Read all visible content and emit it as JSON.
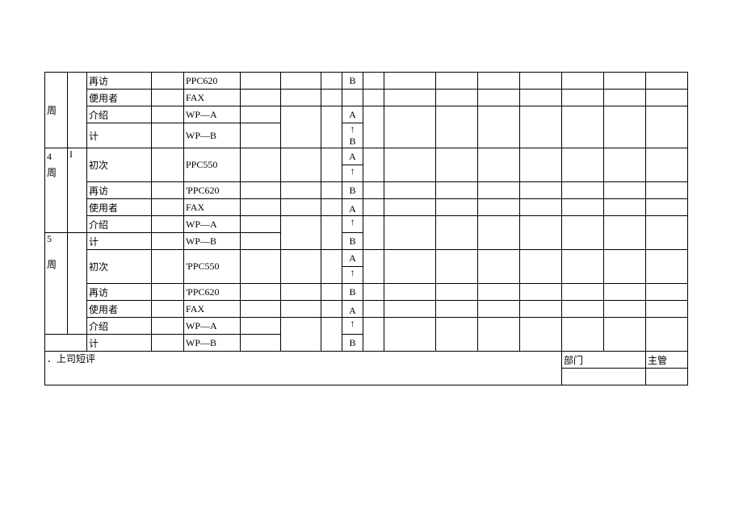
{
  "weeks": [
    {
      "label1": "周",
      "label2": "",
      "marker": ""
    },
    {
      "label1": "4",
      "label2": "周",
      "marker": "I"
    },
    {
      "label1": "5",
      "label2": "周",
      "marker": ""
    }
  ],
  "row_types": {
    "revisit": "再访",
    "user": "便用者",
    "intro": "介绍",
    "total": "计",
    "first": "初次",
    "user2": "使用者"
  },
  "products": {
    "ppc620": "PPC620",
    "ppc620b": "'PPC620",
    "fax": "FAX",
    "wpa": "WP—A",
    "wpb": "WP—B",
    "ppc550": "PPC550",
    "ppc550b": "'PPC550"
  },
  "grades": {
    "a": "A",
    "b": "B",
    "up": "↑"
  },
  "footer": {
    "comment": "．上司短评",
    "dept": "部门",
    "mgr": "主管"
  }
}
